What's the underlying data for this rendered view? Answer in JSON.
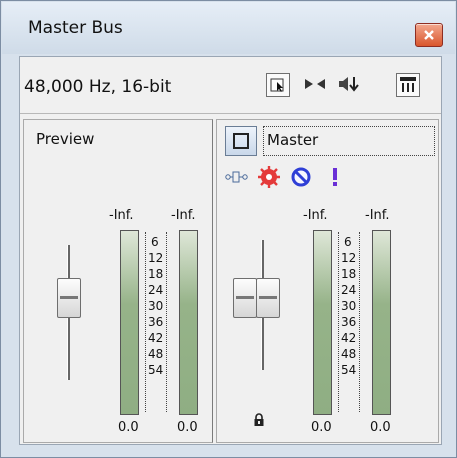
{
  "window": {
    "title": "Master Bus"
  },
  "toolbar": {
    "format": "48,000 Hz, 16-bit",
    "icons": [
      "dim-icon",
      "stereo-link-icon",
      "mute-audio-icon",
      "mixer-console-icon"
    ]
  },
  "preview": {
    "label": "Preview",
    "meters": {
      "left_top": "-Inf.",
      "right_top": "-Inf.",
      "left_peak": "0.0",
      "right_peak": "0.0"
    },
    "scale": [
      "6",
      "12",
      "18",
      "24",
      "30",
      "36",
      "42",
      "48",
      "54"
    ]
  },
  "master": {
    "name": "Master",
    "fx_icons": [
      "route-icon",
      "fx-gear-icon",
      "bypass-icon",
      "alert-icon"
    ],
    "meters": {
      "left_top": "-Inf.",
      "right_top": "-Inf.",
      "left_peak": "0.0",
      "right_peak": "0.0"
    },
    "scale": [
      "6",
      "12",
      "18",
      "24",
      "30",
      "36",
      "42",
      "48",
      "54"
    ]
  }
}
